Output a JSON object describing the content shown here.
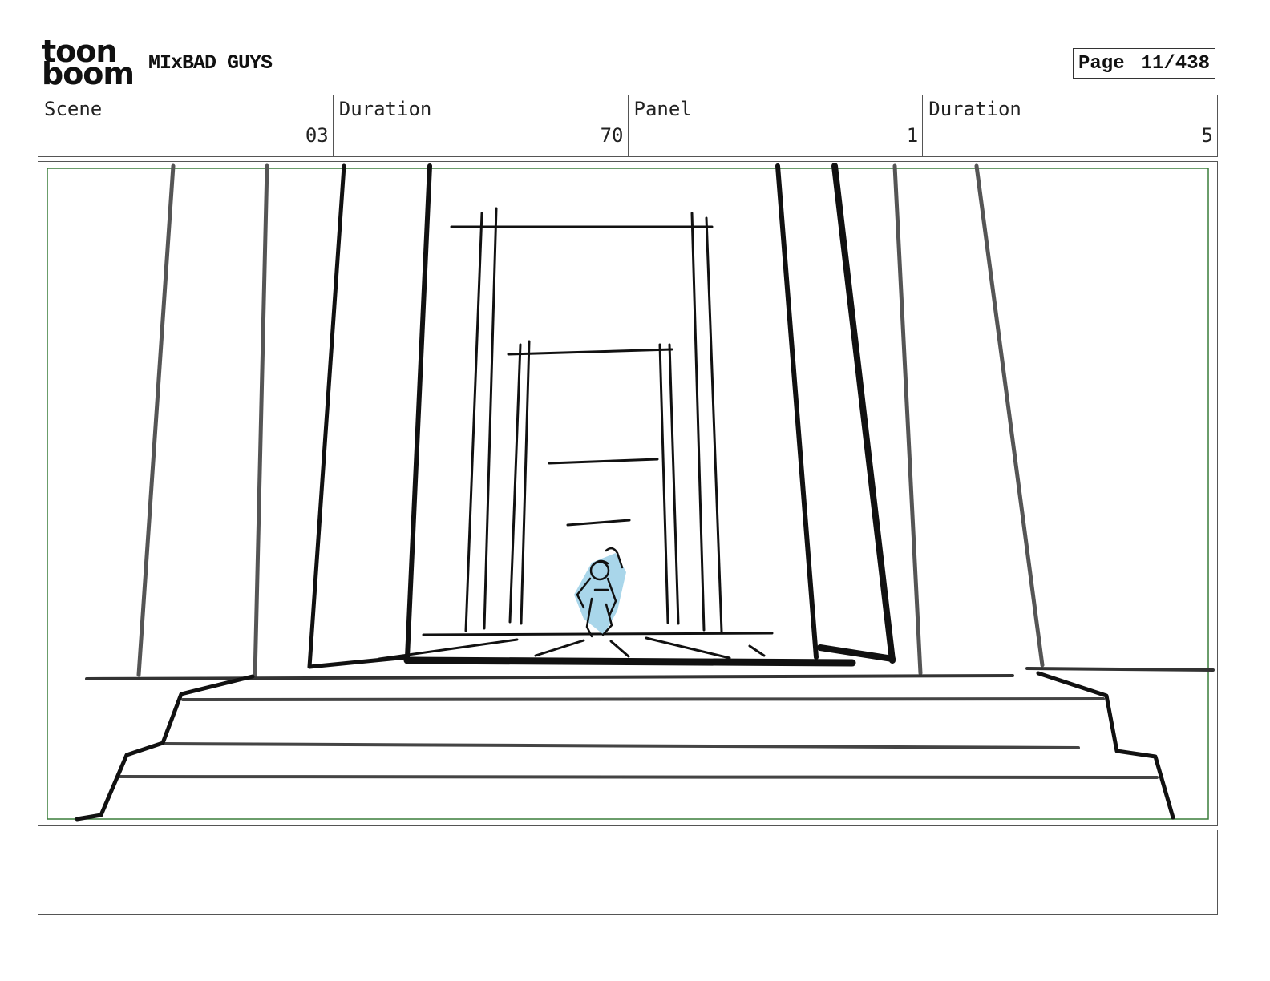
{
  "header": {
    "logo_line1": "toon",
    "logo_line2": "boom",
    "project_title": "MIxBAD GUYS",
    "page_label": "Page",
    "page_number": "11/438"
  },
  "info": {
    "scene_label": "Scene",
    "scene_value": "03",
    "scene_duration_label": "Duration",
    "scene_duration_value": "70",
    "panel_label": "Panel",
    "panel_value": "1",
    "panel_duration_label": "Duration",
    "panel_duration_value": "5"
  },
  "notes": {
    "text": ""
  },
  "colors": {
    "safe_frame": "#3a7d3a",
    "character_fill": "#a9d6ea",
    "ink": "#111111"
  }
}
